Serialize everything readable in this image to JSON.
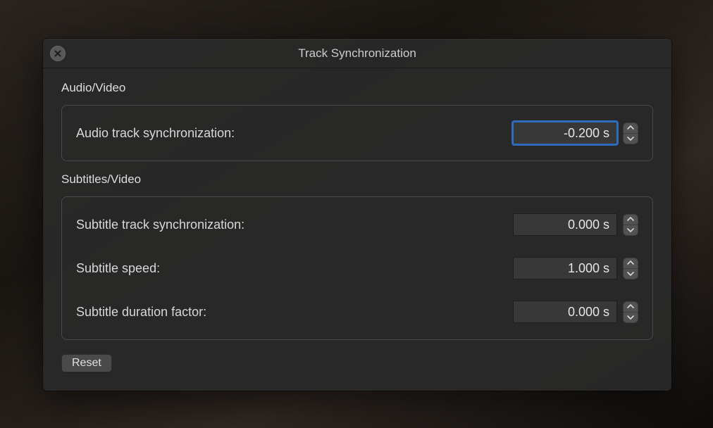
{
  "dialog": {
    "title": "Track Synchronization",
    "sections": {
      "audioVideo": {
        "label": "Audio/Video",
        "rows": {
          "audioSync": {
            "label": "Audio track synchronization:",
            "value": "-0.200 s",
            "focused": true
          }
        }
      },
      "subtitlesVideo": {
        "label": "Subtitles/Video",
        "rows": {
          "subtitleSync": {
            "label": "Subtitle track synchronization:",
            "value": "0.000 s",
            "focused": false
          },
          "subtitleSpeed": {
            "label": "Subtitle speed:",
            "value": "1.000 s",
            "focused": false
          },
          "subtitleDuration": {
            "label": "Subtitle duration factor:",
            "value": "0.000 s",
            "focused": false
          }
        }
      }
    },
    "resetLabel": "Reset"
  }
}
